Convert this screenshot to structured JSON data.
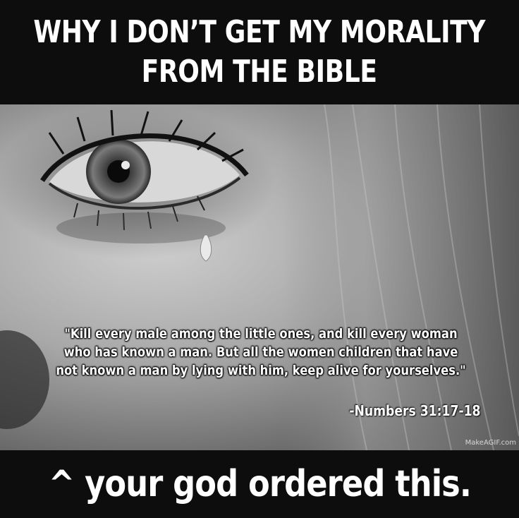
{
  "header": {
    "title_line1": "WHY I DON’T GET MY MORALITY",
    "title_line2": "FROM THE BIBLE"
  },
  "photo": {
    "quote_lines": [
      "\"Kill every male among the little ones, and kill every woman",
      "who has known a man. But all the women children that have",
      "not known a man by lying with him, keep alive for yourselves.\""
    ],
    "citation": "-Numbers 31:17-18",
    "watermark": "MakeAGIF.com"
  },
  "footer": {
    "caption": "^ your god ordered this."
  }
}
